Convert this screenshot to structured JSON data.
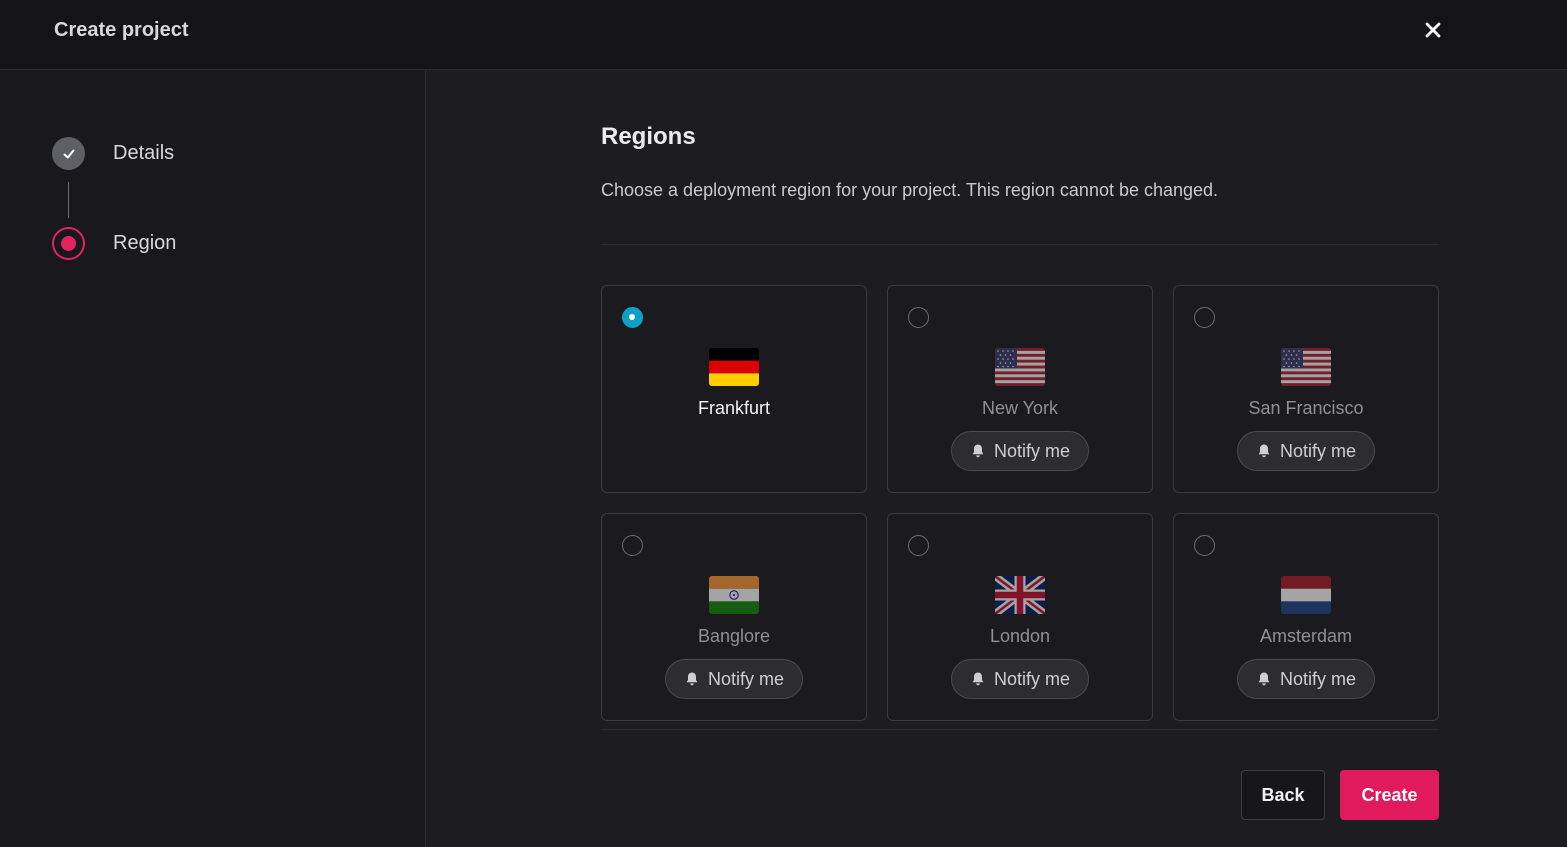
{
  "header": {
    "title": "Create project",
    "close_icon": "close-icon"
  },
  "steps": [
    {
      "label": "Details",
      "status": "completed"
    },
    {
      "label": "Region",
      "status": "current"
    }
  ],
  "main": {
    "title": "Regions",
    "description": "Choose a deployment region for your project. This region cannot be changed."
  },
  "regions": [
    {
      "name": "Frankfurt",
      "flag": "germany-flag",
      "selected": true,
      "notify_label": ""
    },
    {
      "name": "New York",
      "flag": "usa-flag",
      "selected": false,
      "notify_label": "Notify me"
    },
    {
      "name": "San Francisco",
      "flag": "usa-flag",
      "selected": false,
      "notify_label": "Notify me"
    },
    {
      "name": "Banglore",
      "flag": "india-flag",
      "selected": false,
      "notify_label": "Notify me"
    },
    {
      "name": "London",
      "flag": "uk-flag",
      "selected": false,
      "notify_label": "Notify me"
    },
    {
      "name": "Amsterdam",
      "flag": "netherlands-flag",
      "selected": false,
      "notify_label": "Notify me"
    }
  ],
  "footer": {
    "back_label": "Back",
    "create_label": "Create"
  },
  "colors": {
    "accent": "#e01a5c",
    "radio_selected": "#12a0c9",
    "background": "#1c1c21"
  }
}
